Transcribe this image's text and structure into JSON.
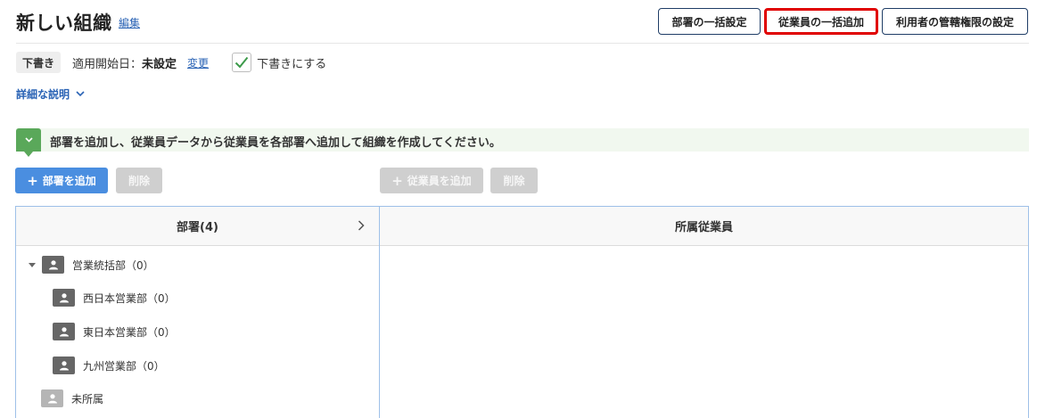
{
  "header": {
    "title": "新しい組織",
    "edit_label": "編集",
    "buttons": {
      "bulk_department": "部署の一括設定",
      "bulk_employee": "従業員の一括追加",
      "user_jurisdiction": "利用者の管轄権限の設定"
    }
  },
  "status": {
    "draft_badge": "下書き",
    "start_date_label": "適用開始日：",
    "start_date_value": "未設定",
    "change_label": "変更",
    "draft_checkbox_label": "下書きにする",
    "draft_checked": true
  },
  "details_toggle": "詳細な説明",
  "info_message": "部署を追加し、従業員データから従業員を各部署へ追加して組織を作成してください。",
  "actions": {
    "add_department": "部署を追加",
    "delete_department": "削除",
    "add_employee": "従業員を追加",
    "delete_employee": "削除"
  },
  "departments_panel": {
    "header": "部署(4)",
    "tree": [
      {
        "label": "営業統括部（0）",
        "level": 0,
        "expanded": true
      },
      {
        "label": "西日本営業部（0）",
        "level": 1
      },
      {
        "label": "東日本営業部（0）",
        "level": 1
      },
      {
        "label": "九州営業部（0）",
        "level": 1
      },
      {
        "label": "未所属",
        "level": 0
      }
    ]
  },
  "members_panel": {
    "header": "所属従業員"
  },
  "colors": {
    "primary": "#4a8ee0",
    "link": "#2a63b5",
    "highlight": "#e00000",
    "info_bg": "#f1f8ef",
    "info_badge": "#5aa85a"
  }
}
